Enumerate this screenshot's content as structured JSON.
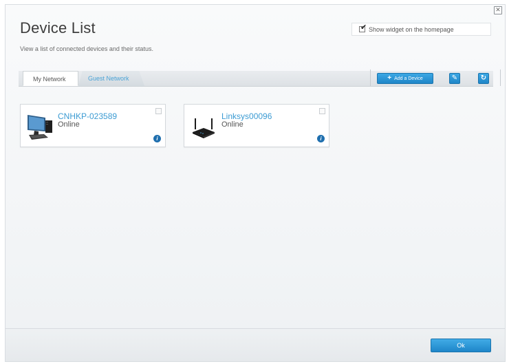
{
  "dialog": {
    "title": "Device List",
    "subtitle": "View a list of connected devices and their status.",
    "close_symbol": "✕",
    "show_widget": {
      "label": "Show widget on the homepage",
      "checked": true
    }
  },
  "tabs": [
    {
      "label": "My Network",
      "active": true
    },
    {
      "label": "Guest Network",
      "active": false
    }
  ],
  "toolbar": {
    "add_device_label": "Add a Device",
    "edit_icon": "pencil-icon",
    "refresh_icon": "refresh-icon"
  },
  "devices": [
    {
      "name": "CNHKP-023589",
      "status": "Online",
      "icon": "desktop-computer-icon"
    },
    {
      "name": "Linksys00096",
      "status": "Online",
      "icon": "router-icon"
    }
  ],
  "footer": {
    "ok_label": "Ok"
  },
  "colors": {
    "accent": "#2a93d5",
    "link": "#3b9bd3",
    "info": "#1f6fae"
  }
}
